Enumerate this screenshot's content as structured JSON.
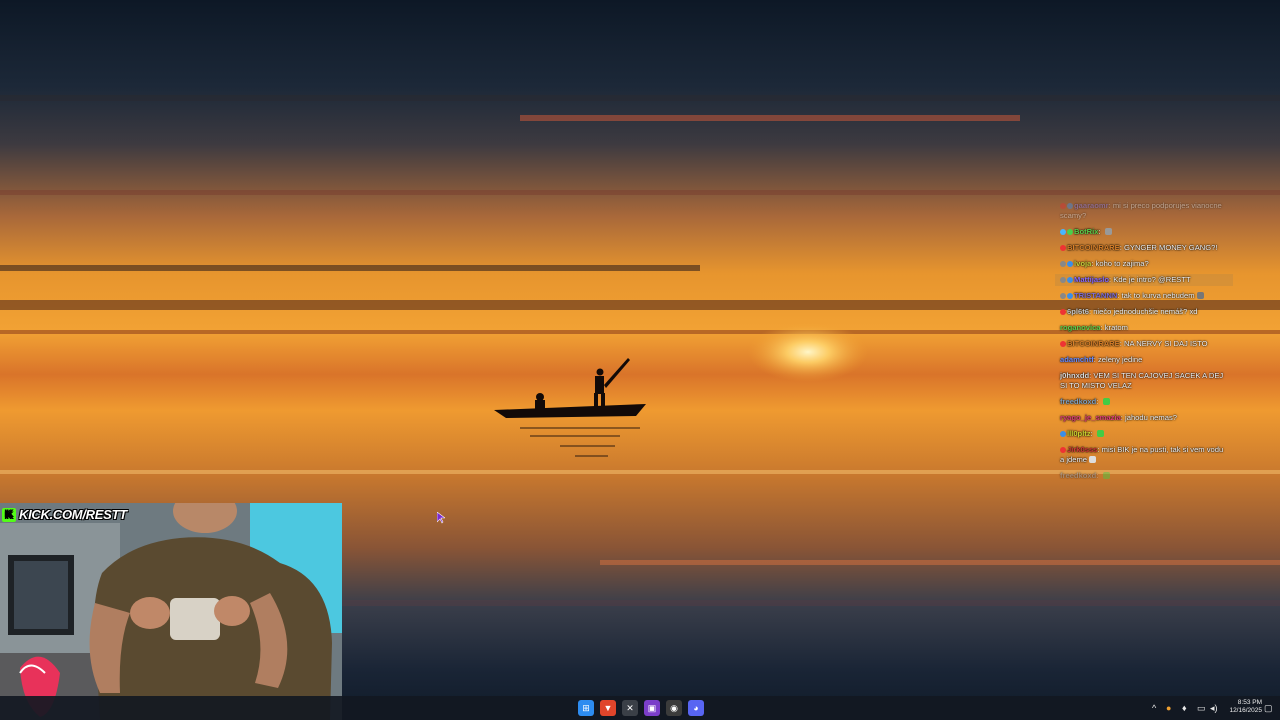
{
  "stream": {
    "channel_url": "KICK.COM/RESTT",
    "kick_logo": "K"
  },
  "chat": {
    "messages": [
      {
        "user": "gaaraomr",
        "user_color": "#8a7cf0",
        "badges": [
          "#d33",
          "#3a8ee8"
        ],
        "text": "mi si preco podporujes vianocne scamy?",
        "faded": true
      },
      {
        "user": "BotRix",
        "user_color": "#5bd14b",
        "badges": [
          "#49b6ff",
          "#49d04a"
        ],
        "text": "",
        "emote": "#999"
      },
      {
        "user": "BITCOINRARE",
        "user_color": "#d9802a",
        "badges": [
          "#e33"
        ],
        "text": "GYNGER MONEY GANG?!"
      },
      {
        "user": "lvoja",
        "user_color": "#c8d33a",
        "badges": [
          "#888",
          "#3a8ee8"
        ],
        "text": "koho to zajima?"
      },
      {
        "user": "Mattijaslo",
        "user_color": "#8a6cff",
        "badges": [
          "#888",
          "#3a8ee8"
        ],
        "text": "Kde je intro? @RESTT",
        "highlight": true
      },
      {
        "user": "TRISTANNN",
        "user_color": "#7f6ed8",
        "badges": [
          "#888",
          "#3a8ee8"
        ],
        "text": "tak to kurva nebudem",
        "emote": "#777"
      },
      {
        "user": "6pl6t6",
        "user_color": "#c8c8c8",
        "badges": [
          "#e33"
        ],
        "text": "niečo jednoduchšie nemáš? xd"
      },
      {
        "user": "roganovica",
        "user_color": "#5fd34f",
        "badges": [],
        "text": "kratom"
      },
      {
        "user": "BITCOINRARE",
        "user_color": "#d9802a",
        "badges": [
          "#e33"
        ],
        "text": "NA NERVY SI DAJ ISTO"
      },
      {
        "user": "adamchtf",
        "user_color": "#6c8cff",
        "badges": [],
        "text": "zeleny jedine"
      },
      {
        "user": "j0hnxdd",
        "user_color": "#dcdcdc",
        "badges": [],
        "text": "VEM SI TEN CAJOVEJ SACEK A DEJ SI TO MISTO VELAZ"
      },
      {
        "user": "freedkoxd",
        "user_color": "#7fa0c0",
        "badges": [],
        "text": "",
        "emote": "#4c4"
      },
      {
        "user": "ryago_je_smazia",
        "user_color": "#e0407a",
        "badges": [],
        "text": "jahodu nemas?"
      },
      {
        "user": "lll0pltz",
        "user_color": "#ccd42f",
        "badges": [
          "#3a8ee8"
        ],
        "text": "",
        "emote": "#4c4"
      },
      {
        "user": "Jirk0sss",
        "user_color": "#d33a3a",
        "badges": [
          "#e33"
        ],
        "text": "misi BIK je na pusti, tak si vem vodu a jdeme",
        "emote": "#ddd"
      },
      {
        "user": "freedkoxd",
        "user_color": "#7fa0c0",
        "badges": [],
        "text": "",
        "emote": "#4c4",
        "faded": true
      }
    ]
  },
  "taskbar": {
    "apps": [
      {
        "name": "windows-start",
        "color": "#2d8cf0",
        "glyph": "⊞"
      },
      {
        "name": "brave",
        "color": "#e0452b",
        "glyph": "▼"
      },
      {
        "name": "excel-like",
        "color": "#3a3f47",
        "glyph": "✕"
      },
      {
        "name": "twitch-like",
        "color": "#7b3ec9",
        "glyph": "▣"
      },
      {
        "name": "obs-like",
        "color": "#3b3b3b",
        "glyph": "◉"
      },
      {
        "name": "discord-like",
        "color": "#5865f2",
        "glyph": "◕"
      }
    ],
    "tray_chevron": "^",
    "time": "8:53 PM",
    "date": "12/16/2025"
  }
}
